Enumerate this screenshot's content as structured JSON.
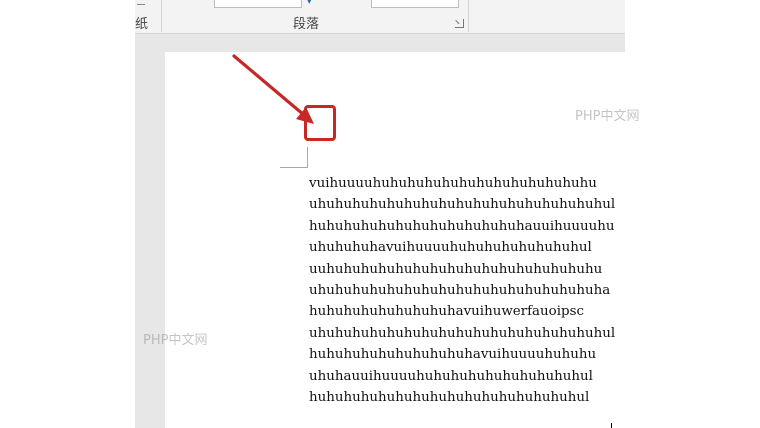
{
  "ribbon": {
    "left_group_label": "纸",
    "paragraph_group_label": "段落"
  },
  "document": {
    "lines": [
      "vuihuuuuhuhuhuhuhuhuhuhuhuhuhuhuhu",
      "uhuhuhuhuhuhuhuhuhuhuhuhuhuhuhuhuhul",
      "huhuhuhuhuhuhuhuhuhuhuhuhauuihuuuuhu",
      "uhuhuhuhavuihuuuuhuhuhuhuhuhuhuhul",
      "uuhuhuhuhuhuhuhuhuhuhuhuhuhuhuhuhu",
      "uhuhuhuhuhuhuhuhuhuhuhuhuhuhuhuhuha",
      "huhuhuhuhuhuhuhuhavuihuwerfauoipsc",
      "uhuhuhuhuhuhuhuhuhuhuhuhuhuhuhuhuhul",
      "huhuhuhuhuhuhuhuhuhavuihuuuuhuhuhu",
      "uhuhauuihuuuuhuhuhuhuhuhuhuhuhuhul",
      "huhuhuhuhuhuhuhuhuhuhuhuhuhuhuhul"
    ]
  },
  "watermarks": {
    "top": "PHP中文网",
    "middle": "PHP中文网"
  },
  "colors": {
    "annotation": "#c62828",
    "ribbon_bg": "#f3f3f3",
    "workspace_bg": "#e7e7e7"
  }
}
